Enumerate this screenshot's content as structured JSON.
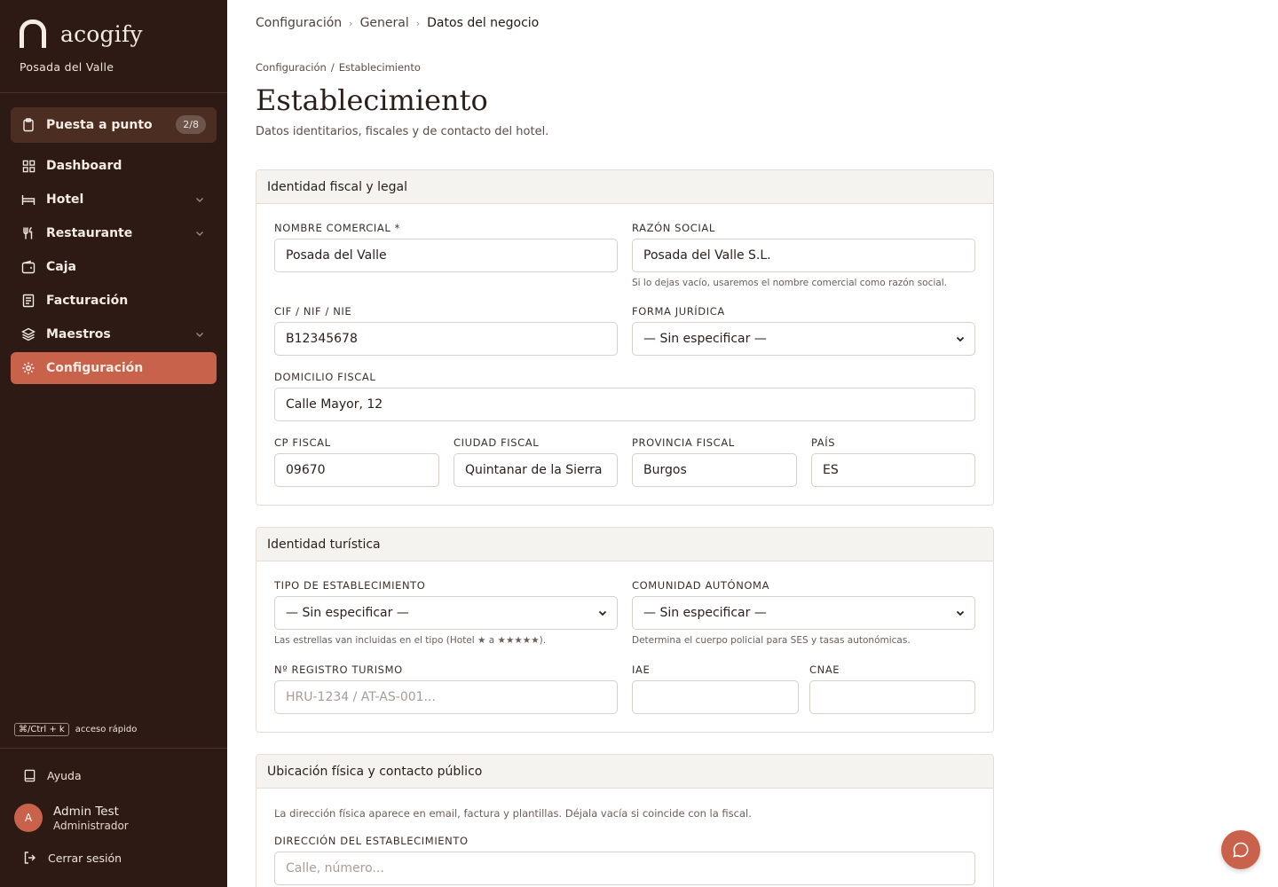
{
  "brand": {
    "name": "acogify",
    "hotel": "Posada del Valle"
  },
  "nav": {
    "setup": {
      "label": "Puesta a punto",
      "badge": "2/8"
    },
    "items": [
      {
        "label": "Dashboard",
        "icon": "grid-icon"
      },
      {
        "label": "Hotel",
        "icon": "bed-icon"
      },
      {
        "label": "Restaurante",
        "icon": "fork-knife-icon"
      },
      {
        "label": "Caja",
        "icon": "wallet-icon"
      },
      {
        "label": "Facturación",
        "icon": "receipt-icon"
      },
      {
        "label": "Maestros",
        "icon": "layers-icon"
      },
      {
        "label": "Configuración",
        "icon": "gear-icon"
      }
    ]
  },
  "shortcut": {
    "keys": "⌘/Ctrl + k",
    "label": "acceso rápido"
  },
  "help": {
    "label": "Ayuda"
  },
  "user": {
    "initial": "A",
    "name": "Admin Test",
    "role": "Administrador"
  },
  "logout": {
    "label": "Cerrar sesión"
  },
  "breadcrumb": {
    "items": [
      "Configuración",
      "General",
      "Datos del negocio"
    ]
  },
  "subcrumb": {
    "items": [
      "Configuración",
      "Establecimiento"
    ],
    "sep": "/"
  },
  "page": {
    "title": "Establecimiento",
    "subtitle": "Datos identitarios, fiscales y de contacto del hotel."
  },
  "fiscal": {
    "title": "Identidad fiscal y legal",
    "nombre_label": "NOMBRE COMERCIAL *",
    "nombre_value": "Posada del Valle",
    "razon_label": "RAZÓN SOCIAL",
    "razon_value": "Posada del Valle S.L.",
    "razon_hint": "Si lo dejas vacío, usaremos el nombre comercial como razón social.",
    "cif_label": "CIF / NIF / NIE",
    "cif_value": "B12345678",
    "forma_label": "FORMA JURÍDICA",
    "forma_value": "— Sin especificar —",
    "domicilio_label": "DOMICILIO FISCAL",
    "domicilio_value": "Calle Mayor, 12",
    "cp_label": "CP FISCAL",
    "cp_value": "09670",
    "ciudad_label": "CIUDAD FISCAL",
    "ciudad_value": "Quintanar de la Sierra",
    "provincia_label": "PROVINCIA FISCAL",
    "provincia_value": "Burgos",
    "pais_label": "PAÍS",
    "pais_value": "ES"
  },
  "turistica": {
    "title": "Identidad turística",
    "tipo_label": "TIPO DE ESTABLECIMIENTO",
    "tipo_value": "— Sin especificar —",
    "tipo_hint": "Las estrellas van incluidas en el tipo (Hotel ★ a ★★★★★).",
    "comunidad_label": "COMUNIDAD AUTÓNOMA",
    "comunidad_value": "— Sin especificar —",
    "comunidad_hint": "Determina el cuerpo policial para SES y tasas autonómicas.",
    "registro_label": "Nº REGISTRO TURISMO",
    "registro_placeholder": "HRU-1234 / AT-AS-001...",
    "iae_label": "IAE",
    "cnae_label": "CNAE"
  },
  "ubicacion": {
    "title": "Ubicación física y contacto público",
    "note": "La dirección física aparece en email, factura y plantillas. Déjala vacía si coincide con la fiscal.",
    "direccion_label": "DIRECCIÓN DEL ESTABLECIMIENTO",
    "direccion_placeholder": "Calle, número..."
  }
}
